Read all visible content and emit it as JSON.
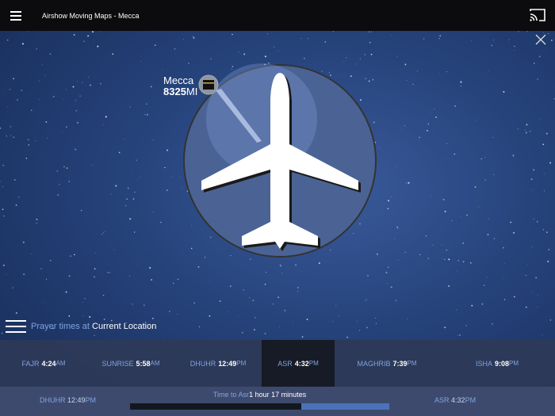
{
  "header": {
    "title": "Airshow Moving Maps - Mecca",
    "menu_icon": "hamburger-icon",
    "cast_icon": "cast-icon",
    "close_icon": "close-icon"
  },
  "map": {
    "destination": "Mecca",
    "distance_value": "8325",
    "distance_unit": "MI"
  },
  "prayer_header": {
    "prefix": "Prayer times at",
    "location": "Current Location"
  },
  "prayers": [
    {
      "name": "FAJR",
      "time": "4:24",
      "ampm": "AM",
      "active": false
    },
    {
      "name": "SUNRISE",
      "time": "5:58",
      "ampm": "AM",
      "active": false
    },
    {
      "name": "DHUHR",
      "time": "12:49",
      "ampm": "PM",
      "active": false
    },
    {
      "name": "ASR",
      "time": "4:32",
      "ampm": "PM",
      "active": true
    },
    {
      "name": "MAGHRIB",
      "time": "7:39",
      "ampm": "PM",
      "active": false
    },
    {
      "name": "ISHA",
      "time": "9:08",
      "ampm": "PM",
      "active": false
    }
  ],
  "countdown": {
    "prev_name": "DHUHR",
    "prev_time": "12:49",
    "prev_ampm": "PM",
    "next_name": "ASR",
    "next_time": "4:32",
    "next_ampm": "PM",
    "label": "Time to Asr",
    "value": "1 hour 17 minutes",
    "progress": 0.66
  },
  "colors": {
    "accent": "#7fa3e0",
    "active_bg": "#171b26",
    "bar_remaining": "#4a72b8"
  }
}
